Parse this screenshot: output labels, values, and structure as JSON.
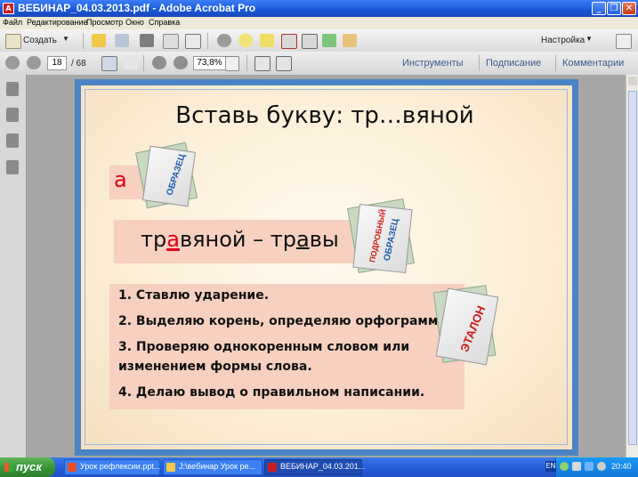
{
  "window": {
    "title": "ВЕБИНАР_04.03.2013.pdf - Adobe Acrobat Pro",
    "app_icon_label": "A"
  },
  "menu": [
    "Файл",
    "Редактирование",
    "Просмотр",
    "Окно",
    "Справка"
  ],
  "toolbar": {
    "create_label": "Создать",
    "settings_label": "Настройка"
  },
  "nav": {
    "current_page": "18",
    "total_pages": "/ 68",
    "zoom": "73,8%"
  },
  "panes": {
    "tools": "Инструменты",
    "sign": "Подписание",
    "comments": "Комментарии"
  },
  "slide": {
    "title": "Вставь букву: тр…вяной",
    "letter": "а",
    "word_parts": [
      "тр",
      "а",
      "вяной – тр",
      "а",
      "вы"
    ],
    "steps": [
      "1.  Ставлю ударение.",
      "2.  Выделяю корень, определяю орфограмму.",
      "3.  Проверяю однокоренным словом или",
      "      изменением формы слова.",
      "4.  Делаю вывод о правильном написании."
    ],
    "stickers": {
      "sample": "ОБРАЗЕЦ",
      "detailed_top": "ПОДРОБНЫЙ",
      "detailed_bottom": "ОБРАЗЕЦ",
      "standard": "ЭТАЛОН"
    }
  },
  "taskbar": {
    "start": "пуск",
    "tasks": [
      "Урок рефлексии.ppt...",
      "J:\\вебинар Урок ре...",
      "ВЕБИНАР_04.03.201..."
    ],
    "lang": "EN",
    "clock": "20:40"
  },
  "colors": {
    "slide_border": "#4b84c4",
    "box_fill": "#f7d0c0",
    "accent_red": "#e2001a",
    "titlebar_blue": "#1b56d8",
    "taskbar_blue": "#245ddb"
  }
}
